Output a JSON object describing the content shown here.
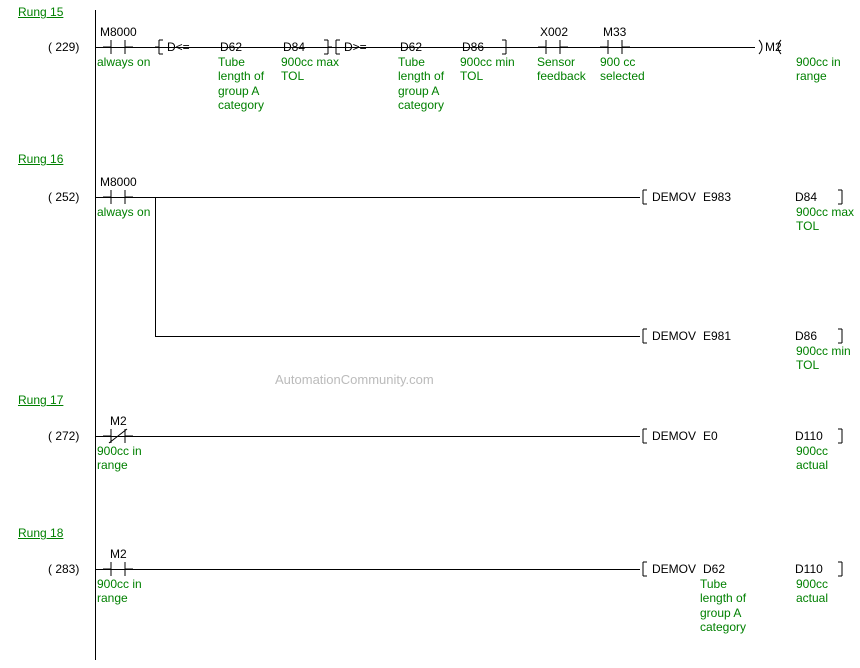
{
  "rung15": {
    "label": "Rung 15",
    "step": "(  229)",
    "e1": {
      "id": "M8000",
      "comment": "always on"
    },
    "cmp1": "D<=",
    "e2": {
      "id": "D62",
      "comment": "Tube length of group A category"
    },
    "e3": {
      "id": "D84",
      "comment": "900cc max TOL"
    },
    "cmp2": "D>=",
    "e4": {
      "id": "D62",
      "comment": "Tube length of group A category"
    },
    "e5": {
      "id": "D86",
      "comment": "900cc min TOL"
    },
    "e6": {
      "id": "X002",
      "comment": "Sensor feedback"
    },
    "e7": {
      "id": "M33",
      "comment": "900 cc selected"
    },
    "coil": {
      "id": "M2",
      "comment": "900cc in range"
    }
  },
  "rung16": {
    "label": "Rung 16",
    "step": "(  252)",
    "e1": {
      "id": "M8000",
      "comment": "always on"
    },
    "box1": {
      "op": "DEMOV",
      "src": "E983",
      "dst": "D84",
      "comment": "900cc max TOL"
    },
    "box2": {
      "op": "DEMOV",
      "src": "E981",
      "dst": "D86",
      "comment": "900cc min TOL"
    }
  },
  "rung17": {
    "label": "Rung 17",
    "step": "(  272)",
    "e1": {
      "id": "M2",
      "comment": "900cc in range"
    },
    "box1": {
      "op": "DEMOV",
      "src": "E0",
      "dst": "D110",
      "comment": "900cc actual"
    }
  },
  "rung18": {
    "label": "Rung 18",
    "step": "(  283)",
    "e1": {
      "id": "M2",
      "comment": "900cc in range"
    },
    "box1": {
      "op": "DEMOV",
      "src": "D62",
      "dst": "D110",
      "srccomment": "Tube length of group A category",
      "comment": "900cc actual"
    }
  },
  "watermark": "AutomationCommunity.com"
}
